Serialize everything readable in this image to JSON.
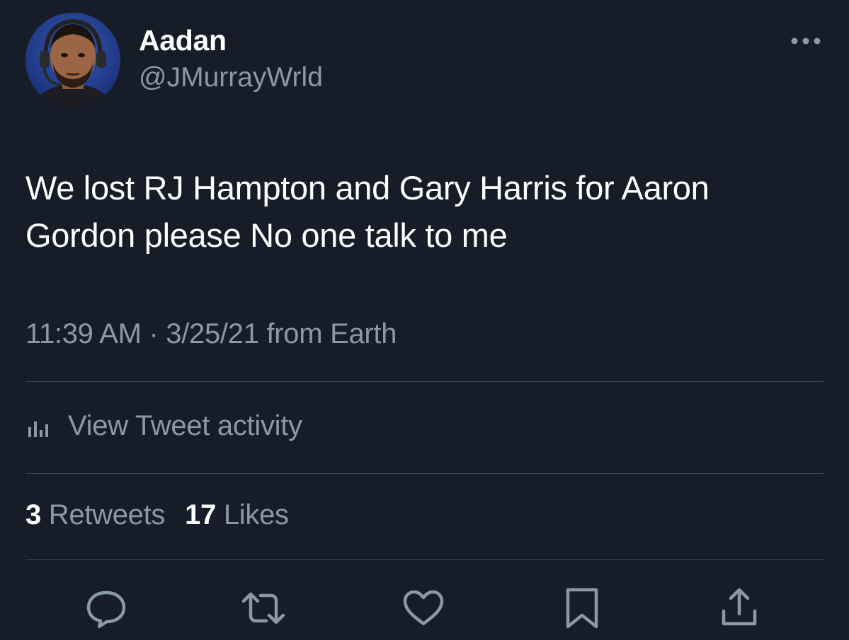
{
  "tweet": {
    "author": {
      "display_name": "Aadan",
      "handle": "@JMurrayWrld"
    },
    "text": "We lost RJ Hampton and Gary Harris for Aaron Gordon please No one talk to me",
    "meta": "11:39 AM · 3/25/21 from Earth",
    "activity_label": "View Tweet activity",
    "stats": {
      "retweets_count": "3",
      "retweets_label": "Retweets",
      "likes_count": "17",
      "likes_label": "Likes"
    },
    "actions": [
      "reply-icon",
      "retweet-icon",
      "like-icon",
      "bookmark-icon",
      "share-icon"
    ]
  },
  "theme": {
    "background": "#161d28",
    "primary_text": "#ffffff",
    "secondary_text": "#8b98a5",
    "divider": "#38444d"
  }
}
